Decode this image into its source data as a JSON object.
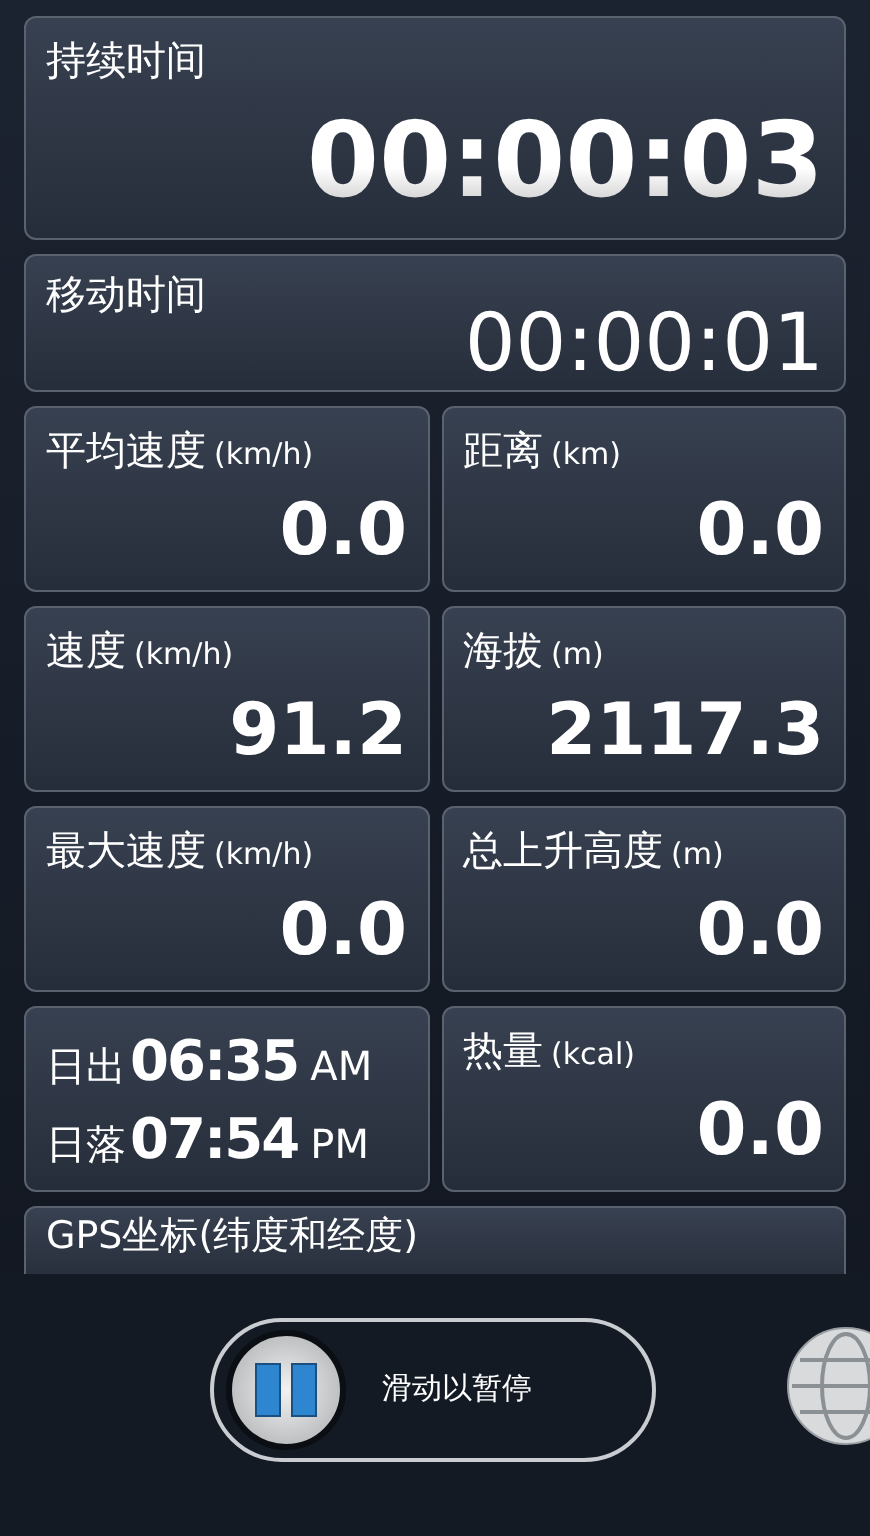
{
  "duration": {
    "label": "持续时间",
    "value": "00:00:03"
  },
  "moving_time": {
    "label": "移动时间",
    "value": "00:00:01"
  },
  "metrics": [
    {
      "kind": "metric",
      "label": "平均速度",
      "unit": "(km/h)",
      "value": "0.0"
    },
    {
      "kind": "metric",
      "label": "距离",
      "unit": "(km)",
      "value": "0.0"
    },
    {
      "kind": "metric",
      "label": "速度",
      "unit": "(km/h)",
      "value": "91.2"
    },
    {
      "kind": "metric",
      "label": "海拔",
      "unit": "(m)",
      "value": "2117.3"
    },
    {
      "kind": "metric",
      "label": "最大速度",
      "unit": "(km/h)",
      "value": "0.0"
    },
    {
      "kind": "metric",
      "label": "总上升高度",
      "unit": "(m)",
      "value": "0.0"
    },
    {
      "kind": "sun",
      "rows": [
        {
          "label": "日出",
          "time": "06:35",
          "ampm": "AM"
        },
        {
          "label": "日落",
          "time": "07:54",
          "ampm": "PM"
        }
      ]
    },
    {
      "kind": "metric",
      "label": "热量",
      "unit": "(kcal)",
      "value": "0.0"
    }
  ],
  "gps": {
    "label": "GPS坐标(纬度和经度)"
  },
  "slider": {
    "label": "滑动以暂停",
    "level": 0
  }
}
